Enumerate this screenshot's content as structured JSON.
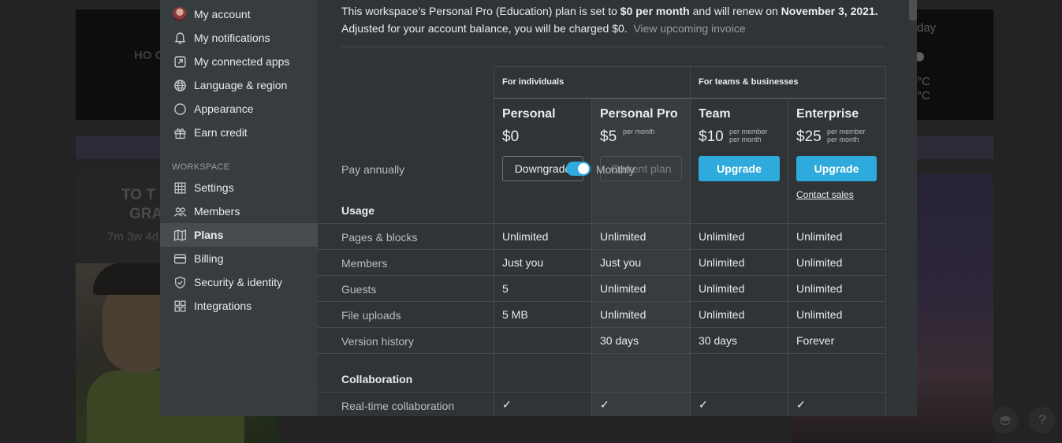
{
  "background": {
    "clock_text": "HO C",
    "day_text": "day",
    "temp_lines": [
      "°C",
      "°C"
    ],
    "card_title_lines": [
      "TO T",
      "GRA"
    ],
    "card_subtitle": "7m 3w 4d",
    "help_button": "?"
  },
  "sidebar": {
    "items_top": [
      {
        "label": "My account",
        "icon": "avatar"
      },
      {
        "label": "My notifications",
        "icon": "bell-icon"
      },
      {
        "label": "My connected apps",
        "icon": "external-link-icon"
      },
      {
        "label": "Language & region",
        "icon": "globe-icon"
      },
      {
        "label": "Appearance",
        "icon": "moon-icon"
      },
      {
        "label": "Earn credit",
        "icon": "gift-icon"
      }
    ],
    "workspace_label": "WORKSPACE",
    "items_workspace": [
      {
        "label": "Settings",
        "icon": "settings-grid-icon"
      },
      {
        "label": "Members",
        "icon": "people-icon"
      },
      {
        "label": "Plans",
        "icon": "map-icon",
        "active": true
      },
      {
        "label": "Billing",
        "icon": "credit-card-icon"
      },
      {
        "label": "Security & identity",
        "icon": "shield-check-icon"
      },
      {
        "label": "Integrations",
        "icon": "grid-icon"
      }
    ]
  },
  "notice": {
    "part1": "This workspace’s Personal Pro (Education) plan is set to ",
    "price": "$0 per month",
    "part2": " and will renew on ",
    "date": "November 3, 2021.",
    "line2": "Adjusted for your account balance, you will be charged $0.",
    "invoice_link": "View upcoming invoice"
  },
  "billing_toggle": {
    "left_label": "Pay annually",
    "right_label": "Monthly",
    "state": "monthly"
  },
  "groups": {
    "individuals": "For individuals",
    "teams": "For teams & businesses"
  },
  "plans": [
    {
      "name": "Personal",
      "price": "$0",
      "per": "",
      "button": "Downgrade",
      "button_style": "outline"
    },
    {
      "name": "Personal Pro",
      "price": "$5",
      "per": "per month",
      "button": "Current plan",
      "button_style": "current"
    },
    {
      "name": "Team",
      "price": "$10",
      "per": "per member\nper month",
      "button": "Upgrade",
      "button_style": "blue"
    },
    {
      "name": "Enterprise",
      "price": "$25",
      "per": "per member\nper month",
      "button": "Upgrade",
      "button_style": "blue",
      "link": "Contact sales"
    }
  ],
  "sections": {
    "usage": "Usage",
    "collaboration": "Collaboration"
  },
  "rows": [
    {
      "label": "Pages & blocks",
      "values": [
        "Unlimited",
        "Unlimited",
        "Unlimited",
        "Unlimited"
      ]
    },
    {
      "label": "Members",
      "values": [
        "Just you",
        "Just you",
        "Unlimited",
        "Unlimited"
      ]
    },
    {
      "label": "Guests",
      "values": [
        "5",
        "Unlimited",
        "Unlimited",
        "Unlimited"
      ]
    },
    {
      "label": "File uploads",
      "values": [
        "5 MB",
        "Unlimited",
        "Unlimited",
        "Unlimited"
      ]
    },
    {
      "label": "Version history",
      "values": [
        "",
        "30 days",
        "30 days",
        "Forever"
      ]
    }
  ],
  "collab_rows": [
    {
      "label": "Real-time collaboration",
      "values": [
        "✓",
        "✓",
        "✓",
        "✓"
      ]
    }
  ],
  "colors": {
    "accent": "#2eaadc",
    "modal_bg": "#2f3437",
    "sidebar_bg": "#373c3f"
  }
}
